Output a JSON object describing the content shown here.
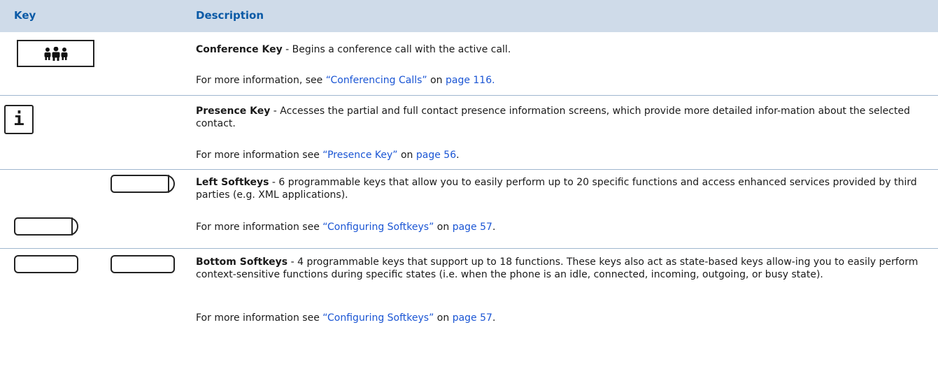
{
  "table": {
    "header_key": "Key",
    "header_description": "Description"
  },
  "rows": [
    {
      "icon": "conference-icon",
      "title": "Conference Key",
      "desc": " - Begins a conference call with the active call.",
      "more_pre": "For more information, see ",
      "link_ref": "“Conferencing Calls”",
      "more_mid": " on ",
      "link_page": "page 116.",
      "more_post": ""
    },
    {
      "icon": "info-icon",
      "icon_glyph": "i",
      "title": "Presence Key",
      "desc": " - Accesses the partial and full contact presence information screens, which provide more detailed infor-mation about the selected contact.",
      "more_pre": "For more information see ",
      "link_ref": "“Presence Key”",
      "more_mid": " on ",
      "link_page": "page 56",
      "more_post": "."
    },
    {
      "icon": "left-softkey-icon",
      "title": "Left Softkeys",
      "desc": " - 6 programmable keys that allow you to easily perform up to 20 specific functions and access enhanced services provided by third parties (e.g. XML applications).",
      "more_pre": "For more information see ",
      "link_ref": "“Configuring Softkeys”",
      "more_mid": " on ",
      "link_page": "page 57",
      "more_post": "."
    },
    {
      "icon": "bottom-softkey-icon",
      "title": "Bottom Softkeys",
      "desc": " - 4 programmable keys that support up to 18 functions. These keys also act as state-based keys allow-ing you to easily perform context-sensitive functions during specific states (i.e. when the phone is an idle, connected, incoming, outgoing, or busy state).",
      "more_pre": "For more information see ",
      "link_ref": "“Configuring Softkeys”",
      "more_mid": " on ",
      "link_page": "page 57",
      "more_post": "."
    }
  ],
  "colors": {
    "header_bg": "#cfdbe9",
    "header_text": "#0b5aa6",
    "link": "#1a55d4"
  }
}
